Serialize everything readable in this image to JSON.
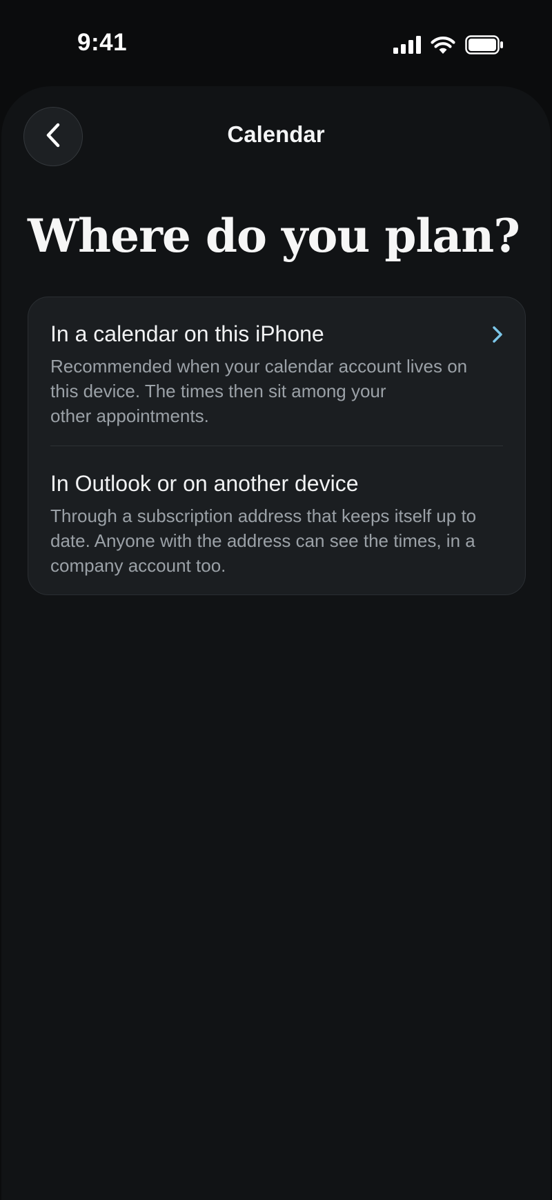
{
  "status_bar": {
    "time": "9:41",
    "icons": [
      "cellular-signal-icon",
      "wifi-icon",
      "battery-icon"
    ]
  },
  "nav": {
    "title": "Calendar",
    "back_icon": "chevron-left-icon"
  },
  "page_title": "Where do you plan?",
  "options": [
    {
      "title": "In a calendar on this iPhone",
      "description_lines": [
        "Recommended when your calendar account lives on",
        "this device. The times then sit among your",
        "other appointments."
      ],
      "icon": "chevron-right-icon"
    },
    {
      "title": "In Outlook or on another device",
      "description_lines": [
        "Through a subscription address that keeps itself up to",
        "date. Anyone with the address can see the times, in a",
        "company account too."
      ]
    }
  ],
  "colors": {
    "background": "#0b0c0d",
    "sheet": "#111315",
    "card": "#1b1e21",
    "accent_chevron": "#7cc6e8",
    "secondary_text": "#9ba1a7"
  }
}
